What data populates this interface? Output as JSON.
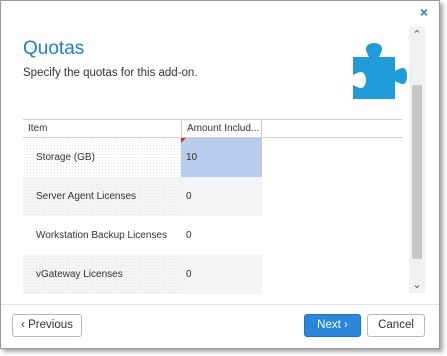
{
  "dialog": {
    "close_icon": "×",
    "title": "Quotas",
    "subtitle": "Specify the quotas for this add-on.",
    "accent_color": "#1f7fd1",
    "icon": "puzzle-piece-icon"
  },
  "table": {
    "columns": [
      "Item",
      "Amount Includ..."
    ],
    "rows": [
      {
        "item": "Storage (GB)",
        "amount": "10"
      },
      {
        "item": "Server Agent Licenses",
        "amount": "0"
      },
      {
        "item": "Workstation Backup Licenses",
        "amount": "0"
      },
      {
        "item": "vGateway Licenses",
        "amount": "0"
      }
    ]
  },
  "scrollbar": {
    "up_arrow": "⌃",
    "down_arrow": "⌄"
  },
  "buttons": {
    "previous": "‹ Previous",
    "next": "Next ›",
    "cancel": "Cancel"
  }
}
